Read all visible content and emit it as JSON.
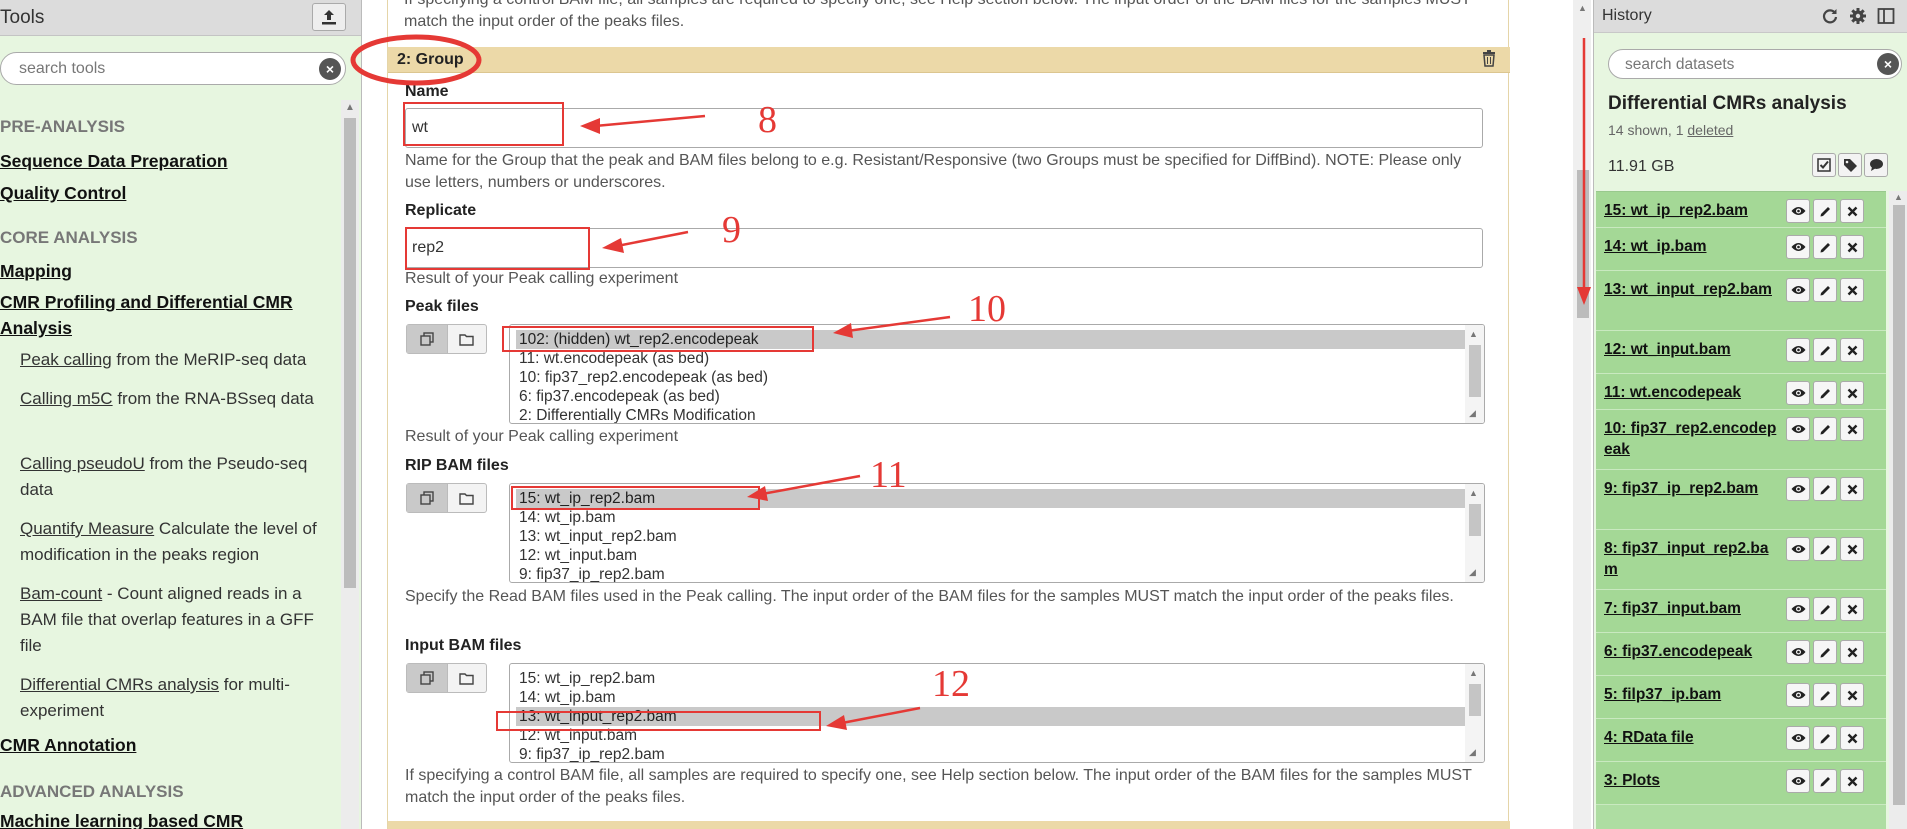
{
  "tools": {
    "title": "Tools",
    "search_placeholder": "search tools",
    "sections": {
      "pre": "PRE-ANALYSIS",
      "core": "CORE ANALYSIS",
      "advanced": "ADVANCED ANALYSIS"
    },
    "categories": {
      "seqprep": "Sequence Data Preparation",
      "qc": "Quality Control",
      "mapping": "Mapping",
      "cmr_profiling": "CMR Profiling and Differential CMR Analysis",
      "cmr_annotation": "CMR Annotation",
      "ml": "Machine learning based CMR"
    },
    "items": [
      {
        "link": "Peak calling",
        "desc": " from the MeRIP-seq data"
      },
      {
        "link": "Calling m5C",
        "desc": " from the RNA-BSseq data"
      },
      {
        "link": "Calling pseudoU",
        "desc": " from the Pseudo-seq data"
      },
      {
        "link": "Quantify Measure",
        "desc": " Calculate the level of modification in the peaks region"
      },
      {
        "link": "Bam-count",
        "desc": " - Count aligned reads in a BAM file that overlap features in a GFF file"
      },
      {
        "link": "Differential CMRs analysis",
        "desc": " for multi-experiment"
      }
    ]
  },
  "form": {
    "top_help": "If specifying a control BAM file, all samples are required to specify one, see Help section below. The input order of the BAM files for the samples MUST match the input order of the peaks files.",
    "group_label": "2: Group",
    "name": {
      "label": "Name",
      "value": "wt",
      "help": "Name for the Group that the peak and BAM files belong to e.g. Resistant/Responsive (two Groups must be specified for DiffBind). NOTE: Please only use letters, numbers or underscores."
    },
    "replicate": {
      "label": "Replicate",
      "value": "rep2",
      "help": "Result of your Peak calling experiment"
    },
    "peak": {
      "label": "Peak files",
      "options": [
        "102: (hidden) wt_rep2.encodepeak",
        "11: wt.encodepeak (as bed)",
        "10: fip37_rep2.encodepeak (as bed)",
        "6: fip37.encodepeak (as bed)",
        "2: Differentially CMRs Modification"
      ],
      "selected": 0,
      "help": "Result of your Peak calling experiment"
    },
    "rip": {
      "label": "RIP BAM files",
      "options": [
        "15: wt_ip_rep2.bam",
        "14: wt_ip.bam",
        "13: wt_input_rep2.bam",
        "12: wt_input.bam",
        "9: fip37_ip_rep2.bam"
      ],
      "selected": 0,
      "help": "Specify the Read BAM files used in the Peak calling. The input order of the BAM files for the samples MUST match the input order of the peaks files."
    },
    "input": {
      "label": "Input BAM files",
      "options": [
        "15: wt_ip_rep2.bam",
        "14: wt_ip.bam",
        "13: wt_input_rep2.bam",
        "12: wt_input.bam",
        "9: fip37_ip_rep2.bam"
      ],
      "selected": 2,
      "help": "If specifying a control BAM file, all samples are required to specify one, see Help section below. The input order of the BAM files for the samples MUST match the input order of the peaks files."
    }
  },
  "annotations": {
    "n8": "8",
    "n9": "9",
    "n10": "10",
    "n11": "11",
    "n12": "12"
  },
  "history": {
    "title": "History",
    "search_placeholder": "search datasets",
    "name": "Differential CMRs analysis",
    "shown": "14 shown, 1 ",
    "deleted": "deleted",
    "size": "11.91 GB",
    "datasets": [
      "15: wt_ip_rep2.bam",
      "14: wt_ip.bam",
      "13: wt_input_rep2.bam",
      "12: wt_input.bam",
      "11: wt.encodepeak",
      "10: fip37_rep2.encodepeak",
      "9: fip37_ip_rep2.bam",
      "8: fip37_input_rep2.bam",
      "7: fip37_input.bam",
      "6: fip37.encodepeak",
      "5: filp37_ip.bam",
      "4: RData file",
      "3: Plots"
    ]
  },
  "colors": {
    "panel_bg": "#e7f6e0",
    "group_bar": "#ecd9a8",
    "dataset_ok": "#a4d896",
    "annotation_red": "#e53935"
  }
}
